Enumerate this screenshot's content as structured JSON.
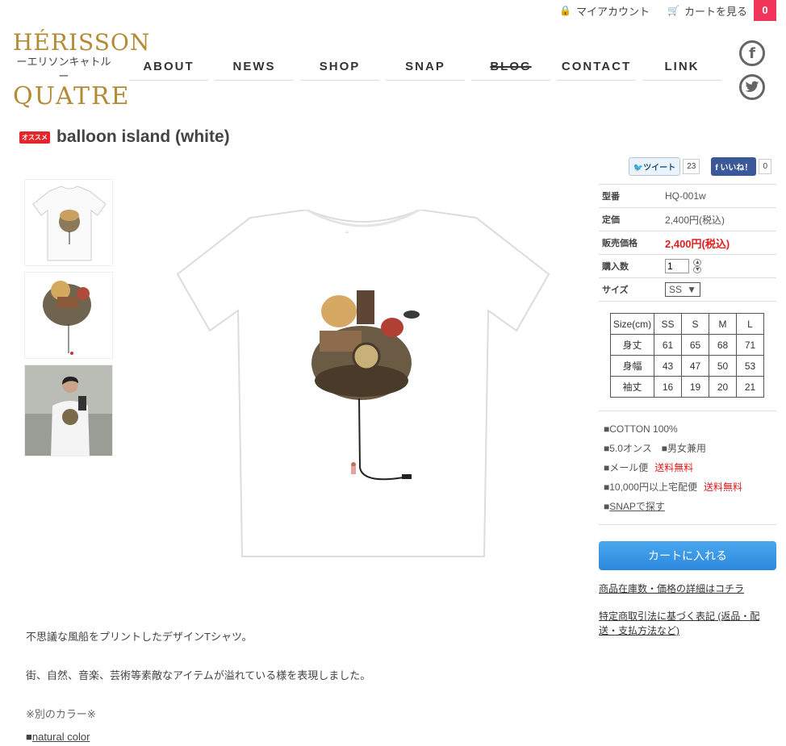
{
  "topbar": {
    "account": "マイアカウント",
    "cart": "カートを見る",
    "cart_count": "0"
  },
  "logo": {
    "line1": "HÉRISSON",
    "line2": "ーエリソンキャトルー",
    "line3": "QUATRE"
  },
  "nav": [
    "ABOUT",
    "NEWS",
    "SHOP",
    "SNAP",
    "BLOG",
    "CONTACT",
    "LINK"
  ],
  "social": {
    "facebook": "f"
  },
  "product": {
    "badge": "オススメ",
    "title": "balloon island (white)"
  },
  "share": {
    "tweet": "ツイート",
    "tweet_count": "23",
    "like": "いいね！",
    "like_count": "0"
  },
  "spec": {
    "model_label": "型番",
    "model": "HQ-001w",
    "price_label": "定価",
    "price": "2,400円(税込)",
    "sale_label": "販売価格",
    "sale": "2,400円(税込)",
    "qty_label": "購入数",
    "qty": "1",
    "size_label": "サイズ",
    "size": "SS"
  },
  "size_table": {
    "headers": [
      "Size(cm)",
      "SS",
      "S",
      "M",
      "L"
    ],
    "rows": [
      [
        "身丈",
        "61",
        "65",
        "68",
        "71"
      ],
      [
        "身幅",
        "43",
        "47",
        "50",
        "53"
      ],
      [
        "袖丈",
        "16",
        "19",
        "20",
        "21"
      ]
    ]
  },
  "features": {
    "cotton": "■COTTON 100%",
    "ounce": "■5.0オンス",
    "unisex": "■男女兼用",
    "mail": "■メール便",
    "mail_free": "送料無料",
    "home": "■10,000円以上宅配便",
    "home_free": "送料無料",
    "snap_prefix": "■",
    "snap_link": "SNAPで探す"
  },
  "cart_button": "カートに入れる",
  "links": {
    "stock": "商品在庫数・価格の詳細はコチラ",
    "law": "特定商取引法に基づく表記 (返品・配送・支払方法など)"
  },
  "description": {
    "p1": "不思議な風船をプリントしたデザインTシャツ。",
    "p2": "街、自然、音楽、芸術等素敵なアイテムが溢れている様を表現しました。",
    "color_head": "※別のカラー※",
    "color_prefix": "■",
    "color_link": "natural color"
  }
}
